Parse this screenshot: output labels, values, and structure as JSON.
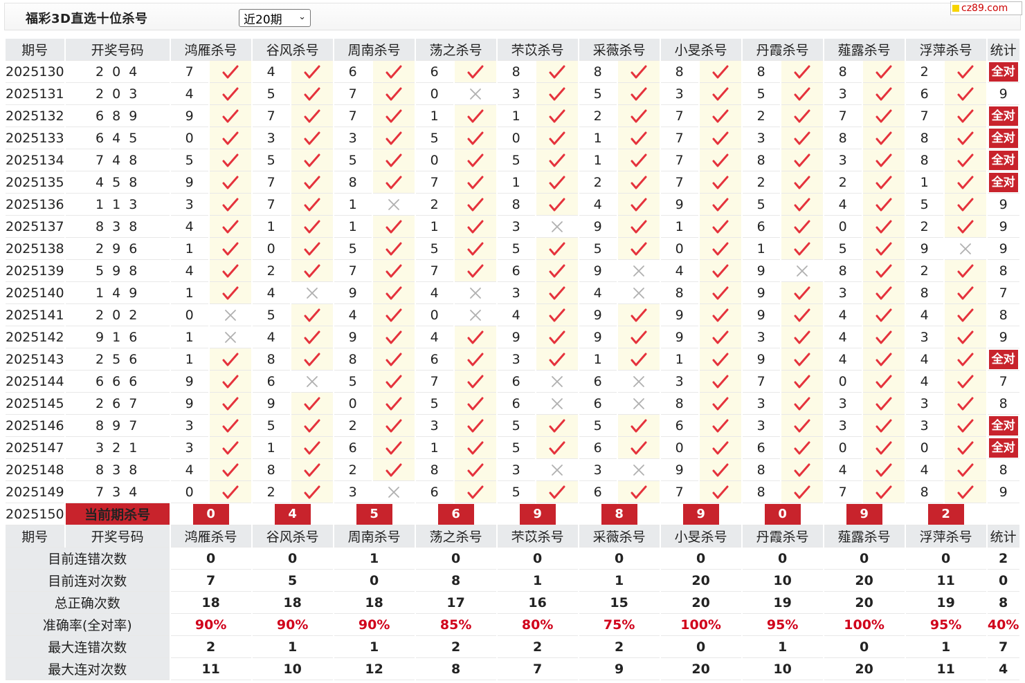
{
  "header": {
    "title": "福彩3D直选十位杀号",
    "period_select": "近20期",
    "logo": "cz89.com"
  },
  "columns": {
    "period": "期号",
    "draw": "开奖号码",
    "experts": [
      "鸿雁杀号",
      "谷风杀号",
      "周南杀号",
      "荡之杀号",
      "芣苡杀号",
      "采薇杀号",
      "小旻杀号",
      "丹霞杀号",
      "薤露杀号",
      "浮萍杀号"
    ],
    "stats": "统计"
  },
  "all_right_label": "全对",
  "rows": [
    {
      "p": "2025130",
      "d": "2 0 4",
      "k": [
        7,
        4,
        6,
        6,
        8,
        8,
        8,
        8,
        8,
        2
      ],
      "h": [
        1,
        1,
        1,
        1,
        1,
        1,
        1,
        1,
        1,
        1
      ],
      "t": "全对"
    },
    {
      "p": "2025131",
      "d": "2 0 3",
      "k": [
        4,
        5,
        7,
        0,
        3,
        5,
        3,
        5,
        3,
        6
      ],
      "h": [
        1,
        1,
        1,
        0,
        1,
        1,
        1,
        1,
        1,
        1
      ],
      "t": "9"
    },
    {
      "p": "2025132",
      "d": "6 8 9",
      "k": [
        9,
        7,
        7,
        1,
        1,
        2,
        7,
        2,
        7,
        7
      ],
      "h": [
        1,
        1,
        1,
        1,
        1,
        1,
        1,
        1,
        1,
        1
      ],
      "t": "全对"
    },
    {
      "p": "2025133",
      "d": "6 4 5",
      "k": [
        0,
        3,
        3,
        5,
        0,
        1,
        7,
        3,
        8,
        8
      ],
      "h": [
        1,
        1,
        1,
        1,
        1,
        1,
        1,
        1,
        1,
        1
      ],
      "t": "全对"
    },
    {
      "p": "2025134",
      "d": "7 4 8",
      "k": [
        5,
        5,
        5,
        0,
        5,
        1,
        7,
        8,
        3,
        8
      ],
      "h": [
        1,
        1,
        1,
        1,
        1,
        1,
        1,
        1,
        1,
        1
      ],
      "t": "全对"
    },
    {
      "p": "2025135",
      "d": "4 5 8",
      "k": [
        9,
        7,
        8,
        7,
        1,
        2,
        7,
        2,
        2,
        1
      ],
      "h": [
        1,
        1,
        1,
        1,
        1,
        1,
        1,
        1,
        1,
        1
      ],
      "t": "全对"
    },
    {
      "p": "2025136",
      "d": "1 1 3",
      "k": [
        3,
        7,
        1,
        2,
        8,
        4,
        9,
        5,
        4,
        5
      ],
      "h": [
        1,
        1,
        0,
        1,
        1,
        1,
        1,
        1,
        1,
        1
      ],
      "t": "9"
    },
    {
      "p": "2025137",
      "d": "8 3 8",
      "k": [
        4,
        1,
        1,
        1,
        3,
        9,
        1,
        6,
        0,
        2
      ],
      "h": [
        1,
        1,
        1,
        1,
        0,
        1,
        1,
        1,
        1,
        1
      ],
      "t": "9"
    },
    {
      "p": "2025138",
      "d": "2 9 6",
      "k": [
        1,
        0,
        5,
        5,
        5,
        5,
        0,
        1,
        5,
        9
      ],
      "h": [
        1,
        1,
        1,
        1,
        1,
        1,
        1,
        1,
        1,
        0
      ],
      "t": "9"
    },
    {
      "p": "2025139",
      "d": "5 9 8",
      "k": [
        4,
        2,
        7,
        7,
        6,
        9,
        4,
        9,
        8,
        2
      ],
      "h": [
        1,
        1,
        1,
        1,
        1,
        0,
        1,
        0,
        1,
        1
      ],
      "t": "8"
    },
    {
      "p": "2025140",
      "d": "1 4 9",
      "k": [
        1,
        4,
        9,
        4,
        3,
        4,
        8,
        9,
        3,
        8
      ],
      "h": [
        1,
        0,
        1,
        0,
        1,
        0,
        1,
        1,
        1,
        1
      ],
      "t": "7"
    },
    {
      "p": "2025141",
      "d": "2 0 2",
      "k": [
        0,
        5,
        4,
        0,
        4,
        9,
        9,
        9,
        4,
        4
      ],
      "h": [
        0,
        1,
        1,
        0,
        1,
        1,
        1,
        1,
        1,
        1
      ],
      "t": "8"
    },
    {
      "p": "2025142",
      "d": "9 1 6",
      "k": [
        1,
        4,
        9,
        4,
        9,
        9,
        9,
        3,
        4,
        3
      ],
      "h": [
        0,
        1,
        1,
        1,
        1,
        1,
        1,
        1,
        1,
        1
      ],
      "t": "9"
    },
    {
      "p": "2025143",
      "d": "2 5 6",
      "k": [
        1,
        8,
        8,
        6,
        3,
        1,
        1,
        9,
        4,
        4
      ],
      "h": [
        1,
        1,
        1,
        1,
        1,
        1,
        1,
        1,
        1,
        1
      ],
      "t": "全对"
    },
    {
      "p": "2025144",
      "d": "6 6 6",
      "k": [
        9,
        6,
        5,
        7,
        6,
        6,
        3,
        7,
        0,
        4
      ],
      "h": [
        1,
        0,
        1,
        1,
        0,
        0,
        1,
        1,
        1,
        1
      ],
      "t": "7"
    },
    {
      "p": "2025145",
      "d": "2 6 7",
      "k": [
        9,
        9,
        0,
        5,
        6,
        6,
        8,
        3,
        3,
        3
      ],
      "h": [
        1,
        1,
        1,
        1,
        0,
        0,
        1,
        1,
        1,
        1
      ],
      "t": "8"
    },
    {
      "p": "2025146",
      "d": "8 9 7",
      "k": [
        3,
        5,
        2,
        3,
        5,
        5,
        6,
        3,
        3,
        3
      ],
      "h": [
        1,
        1,
        1,
        1,
        1,
        1,
        1,
        1,
        1,
        1
      ],
      "t": "全对"
    },
    {
      "p": "2025147",
      "d": "3 2 1",
      "k": [
        3,
        1,
        6,
        1,
        5,
        6,
        0,
        6,
        0,
        0
      ],
      "h": [
        1,
        1,
        1,
        1,
        1,
        1,
        1,
        1,
        1,
        1
      ],
      "t": "全对"
    },
    {
      "p": "2025148",
      "d": "8 3 8",
      "k": [
        4,
        8,
        2,
        8,
        3,
        3,
        9,
        8,
        4,
        4
      ],
      "h": [
        1,
        1,
        1,
        1,
        0,
        0,
        1,
        1,
        1,
        1
      ],
      "t": "8"
    },
    {
      "p": "2025149",
      "d": "7 3 4",
      "k": [
        0,
        2,
        3,
        6,
        5,
        6,
        7,
        8,
        7,
        8
      ],
      "h": [
        1,
        1,
        0,
        1,
        1,
        1,
        1,
        1,
        1,
        1
      ],
      "t": "9"
    }
  ],
  "current": {
    "p": "2025150",
    "label": "当前期杀号",
    "k": [
      0,
      4,
      5,
      6,
      9,
      8,
      9,
      0,
      9,
      2
    ]
  },
  "stats": [
    {
      "label": "目前连错次数",
      "v": [
        "0",
        "0",
        "1",
        "0",
        "0",
        "0",
        "0",
        "0",
        "0",
        "0",
        "2"
      ],
      "rate": false
    },
    {
      "label": "目前连对次数",
      "v": [
        "7",
        "5",
        "0",
        "8",
        "1",
        "1",
        "20",
        "10",
        "20",
        "11",
        "0"
      ],
      "rate": false
    },
    {
      "label": "总正确次数",
      "v": [
        "18",
        "18",
        "18",
        "17",
        "16",
        "15",
        "20",
        "19",
        "20",
        "19",
        "8"
      ],
      "rate": false
    },
    {
      "label": "准确率(全对率)",
      "v": [
        "90%",
        "90%",
        "90%",
        "85%",
        "80%",
        "75%",
        "100%",
        "95%",
        "100%",
        "95%",
        "40%"
      ],
      "rate": true
    },
    {
      "label": "最大连错次数",
      "v": [
        "2",
        "1",
        "1",
        "2",
        "2",
        "2",
        "0",
        "1",
        "0",
        "1",
        "7"
      ],
      "rate": false
    },
    {
      "label": "最大连对次数",
      "v": [
        "11",
        "10",
        "12",
        "8",
        "7",
        "9",
        "20",
        "10",
        "20",
        "11",
        "4"
      ],
      "rate": false
    }
  ],
  "colors": {
    "badge": "#c8232c",
    "draw": "#d0021b",
    "stat_value": "#1d4bbf",
    "check": "#e5323c",
    "cross": "#b0b0b0"
  }
}
